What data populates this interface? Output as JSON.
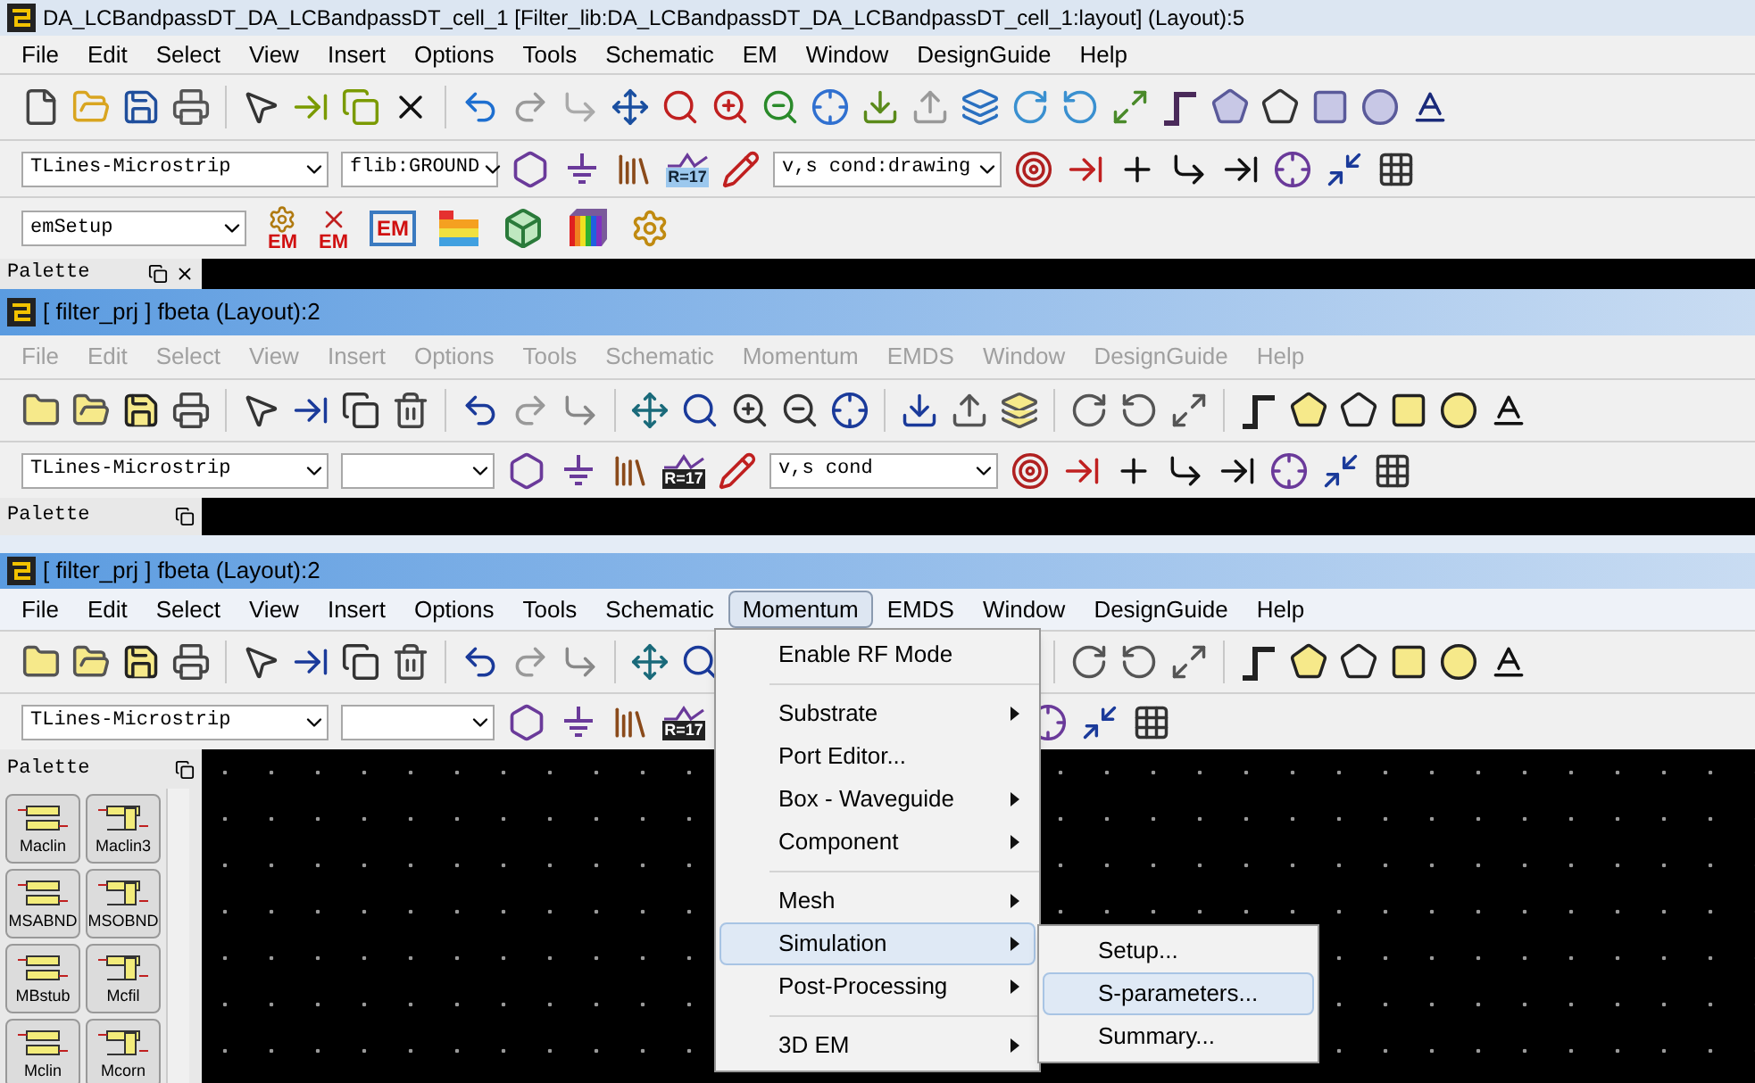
{
  "main_window": {
    "title": "DA_LCBandpassDT_DA_LCBandpassDT_cell_1 [Filter_lib:DA_LCBandpassDT_DA_LCBandpassDT_cell_1:layout] (Layout):5",
    "menu": [
      "File",
      "Edit",
      "Select",
      "View",
      "Insert",
      "Options",
      "Tools",
      "Schematic",
      "EM",
      "Window",
      "DesignGuide",
      "Help"
    ],
    "component_library": "TLines-Microstrip",
    "component": "flib:GROUND",
    "icon_text": "R=17",
    "snap_mode": "v,s cond:drawing",
    "em_setup": "emSetup",
    "em_labels": [
      "EM",
      "EM",
      "EM"
    ],
    "palette": {
      "title": "Palette"
    }
  },
  "window_2": {
    "title": "[ filter_prj ] fbeta (Layout):2",
    "menu": [
      {
        "label": "File",
        "disabled": true
      },
      {
        "label": "Edit",
        "disabled": true
      },
      {
        "label": "Select",
        "disabled": true
      },
      {
        "label": "View",
        "disabled": true
      },
      {
        "label": "Insert",
        "disabled": true
      },
      {
        "label": "Options",
        "disabled": true
      },
      {
        "label": "Tools",
        "disabled": true
      },
      {
        "label": "Schematic",
        "disabled": true
      },
      {
        "label": "Momentum",
        "disabled": true
      },
      {
        "label": "EMDS",
        "disabled": true
      },
      {
        "label": "Window",
        "disabled": true
      },
      {
        "label": "DesignGuide",
        "disabled": true
      },
      {
        "label": "Help",
        "disabled": true
      }
    ],
    "component_library": "TLines-Microstrip",
    "icon_text": "R=17",
    "snap_mode": "v,s cond",
    "palette": {
      "title": "Palette"
    }
  },
  "window_3": {
    "title": "[ filter_prj ] fbeta (Layout):2",
    "menu": [
      {
        "label": "File",
        "selected": false
      },
      {
        "label": "Edit",
        "selected": false
      },
      {
        "label": "Select",
        "selected": false
      },
      {
        "label": "View",
        "selected": false
      },
      {
        "label": "Insert",
        "selected": false
      },
      {
        "label": "Options",
        "selected": false
      },
      {
        "label": "Tools",
        "selected": false
      },
      {
        "label": "Schematic",
        "selected": false
      },
      {
        "label": "Momentum",
        "selected": true
      },
      {
        "label": "EMDS",
        "selected": false
      },
      {
        "label": "Window",
        "selected": false
      },
      {
        "label": "DesignGuide",
        "selected": false
      },
      {
        "label": "Help",
        "selected": false
      }
    ],
    "component_library": "TLines-Microstrip",
    "icon_text": "R=17",
    "palette": {
      "title": "Palette",
      "items": [
        "Maclin",
        "Maclin3",
        "MSABND",
        "MSOBND",
        "MBstub",
        "Mcfil",
        "Mclin",
        "Mcorn"
      ]
    },
    "dropdown": {
      "items": [
        {
          "kind": "item",
          "label": "Enable RF Mode",
          "has_submenu": false,
          "selected": false
        },
        {
          "kind": "separator"
        },
        {
          "kind": "item",
          "label": "Substrate",
          "has_submenu": true,
          "selected": false
        },
        {
          "kind": "item",
          "label": "Port Editor...",
          "has_submenu": false,
          "selected": false
        },
        {
          "kind": "item",
          "label": "Box - Waveguide",
          "has_submenu": true,
          "selected": false
        },
        {
          "kind": "item",
          "label": "Component",
          "has_submenu": true,
          "selected": false
        },
        {
          "kind": "separator"
        },
        {
          "kind": "item",
          "label": "Mesh",
          "has_submenu": true,
          "selected": false
        },
        {
          "kind": "item",
          "label": "Simulation",
          "has_submenu": true,
          "selected": true
        },
        {
          "kind": "item",
          "label": "Post-Processing",
          "has_submenu": true,
          "selected": false
        },
        {
          "kind": "separator"
        },
        {
          "kind": "item",
          "label": "3D EM",
          "has_submenu": true,
          "selected": false
        }
      ]
    },
    "submenu": {
      "items": [
        {
          "label": "Setup...",
          "selected": false
        },
        {
          "label": "S-parameters...",
          "selected": true
        },
        {
          "label": "Summary...",
          "selected": false
        }
      ]
    }
  }
}
